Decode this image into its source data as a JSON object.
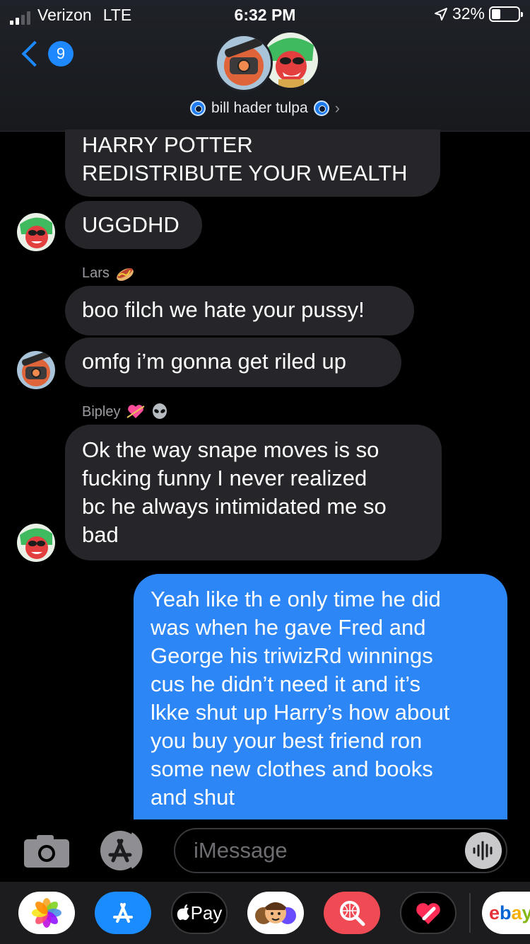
{
  "status_bar": {
    "carrier": "Verizon",
    "network": "LTE",
    "time": "6:32 PM",
    "battery": "32%"
  },
  "header": {
    "back_count": "9",
    "group_name": "bill hader tulpa"
  },
  "messages": {
    "m1": {
      "lines": [
        "HARRY POTTER",
        "REDISTRIBUTE YOUR WEALTH"
      ]
    },
    "m2": {
      "text": "UGGDHD"
    },
    "lars": {
      "name": "Lars"
    },
    "m3": {
      "text": "boo filch we hate your pussy!"
    },
    "m4": {
      "text": "omfg i’m gonna get riled up"
    },
    "bipley": {
      "name": "Bipley"
    },
    "m5": {
      "lines": [
        "Ok the way snape moves is so",
        "fucking funny I never realized",
        "bc he always intimidated me so",
        "bad"
      ]
    },
    "m6": {
      "lines": [
        "Yeah like th e only time he did",
        "was when he gave Fred and",
        "George his triwizRd winnings",
        "cus he didn’t need it and it’s",
        "lkke shut up Harry’s how about",
        "you buy your best friend ron",
        "some new clothes and books",
        "and shut"
      ]
    }
  },
  "compose": {
    "placeholder": "iMessage"
  },
  "drawer": {
    "applepay_label": "Pay",
    "ebay_label": "ebay"
  },
  "icons": [
    "camera-icon",
    "app-store-icon",
    "audio-message-icon",
    "photos-app-icon",
    "apple-pay-icon",
    "memoji-icon",
    "web-search-icon",
    "digital-touch-icon",
    "ebay-icon",
    "hotdog-emoji",
    "heart-arrow-emoji",
    "alien-emoji"
  ],
  "colors": {
    "accent": "#1e88ff",
    "outgoing_bubble": "#2d86f5",
    "incoming_bubble": "#26252a"
  }
}
